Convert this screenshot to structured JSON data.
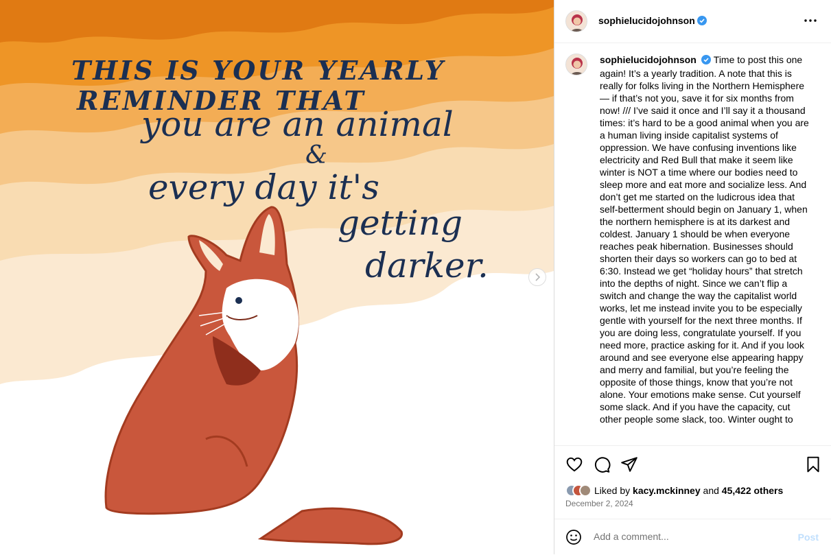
{
  "post_image": {
    "colors": {
      "band_1": "#e07a13",
      "band_2": "#ee9526",
      "band_3": "#f3ad55",
      "band_4": "#f6c789",
      "band_5": "#f9dcb2",
      "band_6": "#fbe9d1",
      "ink": "#1b2f52",
      "fox": "#c9573c",
      "fox_outline": "#a33b20"
    },
    "text_line_1": "THIS IS YOUR YEARLY",
    "text_line_2": "REMINDER THAT",
    "text_line_3": "you are an animal",
    "text_line_4": "&",
    "text_line_5": "every day it's",
    "text_line_6": "getting",
    "text_line_7": "darker."
  },
  "header": {
    "username": "sophielucidojohnson",
    "verified": true,
    "more_icon": "more-horizontal-icon"
  },
  "caption": {
    "username": "sophielucidojohnson",
    "text": "Time to post this one again! It’s a yearly tradition. A note that this is really for folks living in the Northern Hemisphere — if that’s not you, save it for six months from now! /// I’ve said it once and I’ll say it a thousand times: it’s hard to be a good animal when you are a human living inside capitalist systems of oppression. We have confusing inventions like electricity and Red Bull that make it seem like winter is NOT a time where our bodies need to sleep more and eat more and socialize less. And don’t get me started on the ludicrous idea that self-betterment should begin on January 1, when the northern hemisphere is at its darkest and coldest. January 1 should be when everyone reaches peak hibernation. Businesses should shorten their days so workers can go to bed at 6:30. Instead we get “holiday hours” that stretch into the depths of night. Since we can’t flip a switch and change the way the capitalist world works, let me instead invite you to be especially gentle with yourself for the next three months. If you are doing less, congratulate yourself. If you need more, practice asking for it. And if you look around and see everyone else appearing happy and merry and familial, but you’re feeling the opposite of those things, know that you’re not alone. Your emotions make sense. Cut yourself some slack. And if you have the capacity, cut other people some slack, too. Winter ought to"
  },
  "actions": {
    "like_icon": "heart-icon",
    "comment_icon": "comment-icon",
    "share_icon": "send-icon",
    "save_icon": "bookmark-icon"
  },
  "likes": {
    "prefix": "Liked by",
    "user": "kacy.mckinney",
    "middle": "and",
    "others": "45,422 others"
  },
  "date": "December 2, 2024",
  "comment": {
    "placeholder": "Add a comment...",
    "post_label": "Post"
  }
}
